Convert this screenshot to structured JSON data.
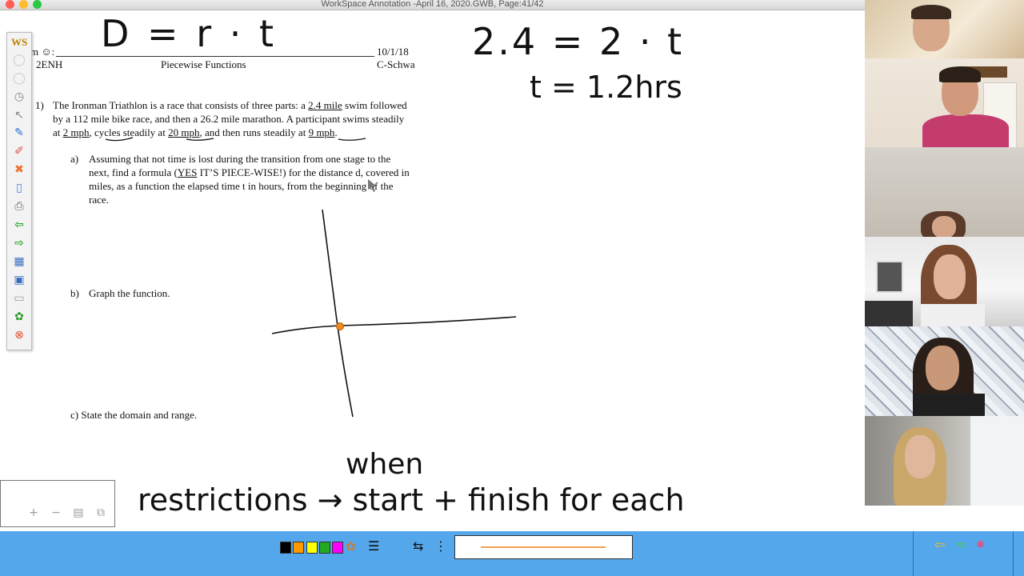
{
  "window": {
    "title": "WorkSpace Annotation -April 16, 2020.GWB, Page:41/42"
  },
  "worksheet": {
    "header_left_top": "m ☺:",
    "header_left_bottom": "2ENH",
    "header_center": "Piecewise Functions",
    "header_date": "10/1/18",
    "header_teacher": "C-Schwa",
    "problem_number": "1)",
    "problem_line1_pre": "The Ironman Triathlon is a race that consists of three parts: a ",
    "problem_line1_u": "2.4 mile",
    "problem_line1_post": " swim followed",
    "problem_line2": "by a 112 mile bike race, and then a 26.2 mile marathon. A participant swims steadily",
    "problem_line3_pre": "at ",
    "problem_line3_u1": "2 mph",
    "problem_line3_mid1": ", cycles steadily at ",
    "problem_line3_u2": "20 mph",
    "problem_line3_mid2": ", and then runs steadily at ",
    "problem_line3_u3": "9 mph",
    "problem_line3_post": ".",
    "part_a_label": "a)",
    "part_a_line1": "Assuming that not time is lost during the transition from one stage to the",
    "part_a_line2_pre": "next, find a formula (",
    "part_a_line2_u": "YES",
    "part_a_line2_post": " IT’S PIECE-WISE!) for the distance d, covered in",
    "part_a_line3": "miles, as a function the elapsed time t in hours, from the beginning of the",
    "part_a_line4": "race.",
    "part_b_label": "b)",
    "part_b_text": "Graph the function.",
    "part_c_text": "c) State the domain and range."
  },
  "handwriting": {
    "formula": "D = r · t",
    "equation1": "2.4 = 2 · t",
    "equation2": "t = 1.2hrs",
    "note_when": "when",
    "note_main": "restrictions → start + finish for each"
  },
  "toolbar": {
    "logo": "WS",
    "icons": [
      "ws-logo-icon",
      "circle-icon",
      "circle-icon",
      "clock-icon",
      "arrow-cursor-icon",
      "pen-icon",
      "highlighter-icon",
      "eraser-x-icon",
      "page-icon",
      "printer-icon",
      "back-arrow-icon",
      "forward-arrow-icon",
      "grid-icon",
      "save-icon",
      "stamp-icon",
      "palette-icon",
      "close-icon"
    ]
  },
  "palette": {
    "colors": [
      "#000000",
      "#ff9900",
      "#ffff00",
      "#22aa22",
      "#ff00ff"
    ],
    "accent_line": "#f0a050",
    "bar_color": "#55a7ec"
  },
  "zoom": {
    "plus": "+",
    "minus": "−"
  },
  "navigation": {
    "back": "⇦",
    "forward": "⇨"
  }
}
